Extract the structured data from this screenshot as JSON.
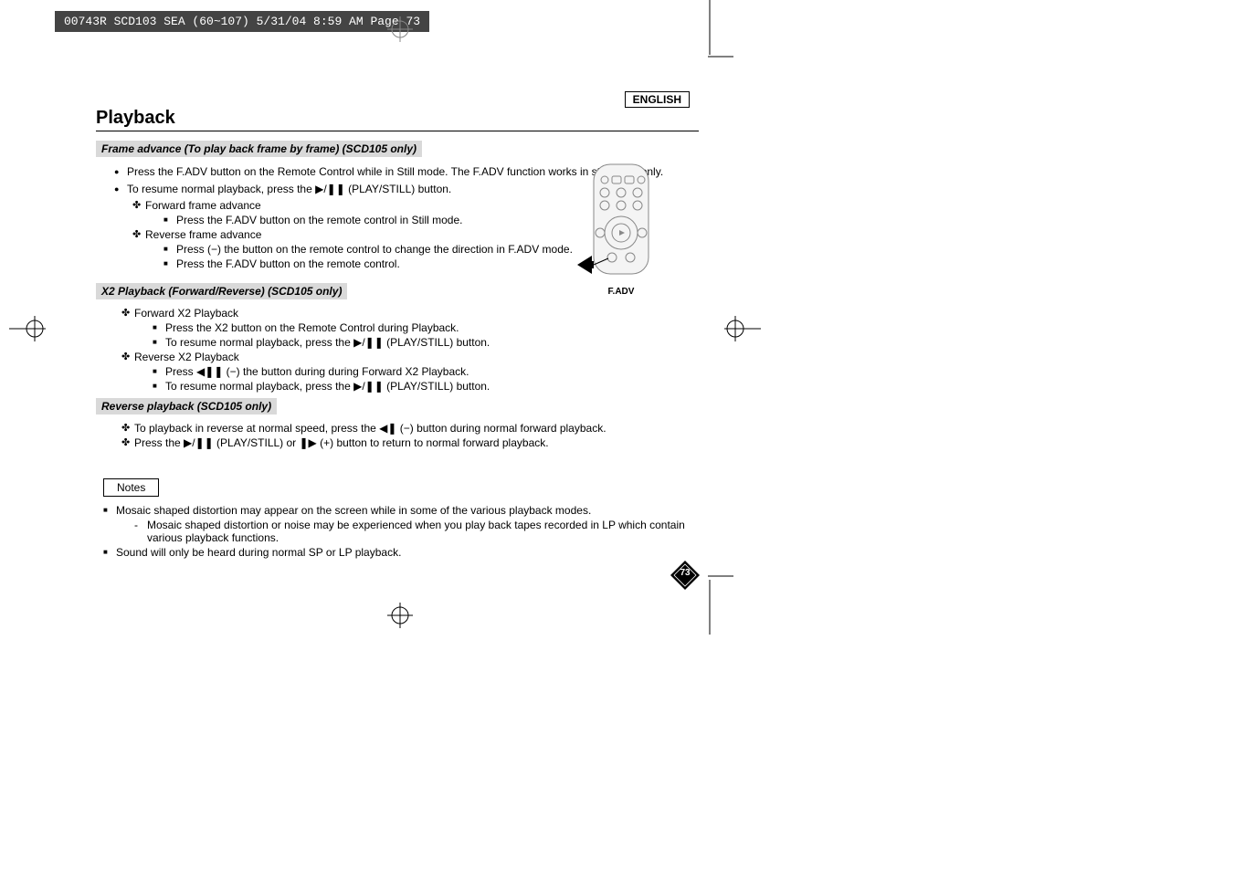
{
  "header": {
    "imprint": "00743R SCD103 SEA (60~107)  5/31/04 8:59 AM  Page 73"
  },
  "language": "ENGLISH",
  "title": "Playback",
  "sections": {
    "frame_advance": {
      "heading": "Frame advance (To play back frame by frame) (SCD105 only)",
      "items": [
        "Press the F.ADV button on the Remote Control while in Still mode. The F.ADV function works in still mode only.",
        "To resume normal playback, press the ▶/❚❚ (PLAY/STILL) button."
      ],
      "sub": {
        "forward": {
          "label": "Forward frame advance",
          "steps": [
            "Press the F.ADV button on the remote control in Still mode."
          ]
        },
        "reverse": {
          "label": "Reverse frame advance",
          "steps": [
            "Press       (−) the button on the remote control to change the direction in F.ADV mode.",
            "Press the F.ADV button on the remote control."
          ]
        }
      }
    },
    "x2": {
      "heading": "X2 Playback (Forward/Reverse) (SCD105 only)",
      "forward": {
        "label": "Forward X2 Playback",
        "steps": [
          "Press the X2 button on the Remote Control during Playback.",
          "To resume normal playback, press the ▶/❚❚ (PLAY/STILL) button."
        ]
      },
      "reverse": {
        "label": "Reverse X2 Playback",
        "steps": [
          "Press ◀❚❚ (−) the button during during Forward X2 Playback.",
          "To resume normal playback, press the ▶/❚❚ (PLAY/STILL) button."
        ]
      }
    },
    "reverse_playback": {
      "heading": "Reverse playback (SCD105 only)",
      "items": [
        "To playback in reverse at normal speed, press the ◀❚ (−) button during normal forward playback.",
        "Press the ▶/❚❚ (PLAY/STILL) or ❚▶ (+) button to return to normal forward playback."
      ]
    }
  },
  "notes": {
    "label": "Notes",
    "items": [
      {
        "text": "Mosaic shaped distortion may appear on the screen while in some of the various playback modes.",
        "sub": "Mosaic shaped distortion or noise may be experienced when you play back tapes recorded in LP which contain various playback functions."
      },
      {
        "text": "Sound will only be heard during normal SP or LP playback."
      }
    ]
  },
  "remote_label": "F.ADV",
  "page_number": "73"
}
